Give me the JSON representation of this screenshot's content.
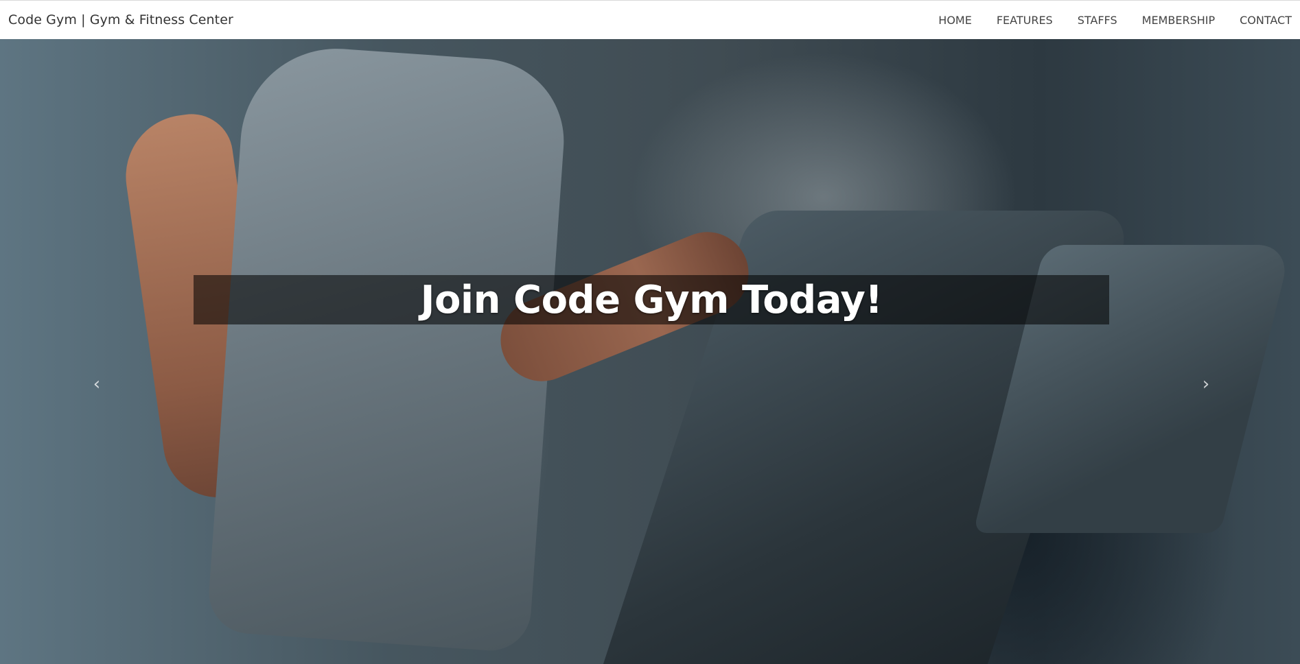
{
  "navbar": {
    "brand": "Code Gym | Gym & Fitness Center",
    "links": [
      {
        "label": "HOME"
      },
      {
        "label": "FEATURES"
      },
      {
        "label": "STAFFS"
      },
      {
        "label": "MEMBERSHIP"
      },
      {
        "label": "CONTACT"
      }
    ]
  },
  "hero": {
    "title": "Join Code Gym Today!",
    "prev_icon": "chevron-left-icon",
    "next_icon": "chevron-right-icon",
    "prev_glyph": "‹",
    "next_glyph": "›"
  },
  "colors": {
    "navbar_bg": "#ffffff",
    "banner_bg": "rgba(0,0,0,0.55)",
    "title_color": "#ffffff"
  }
}
